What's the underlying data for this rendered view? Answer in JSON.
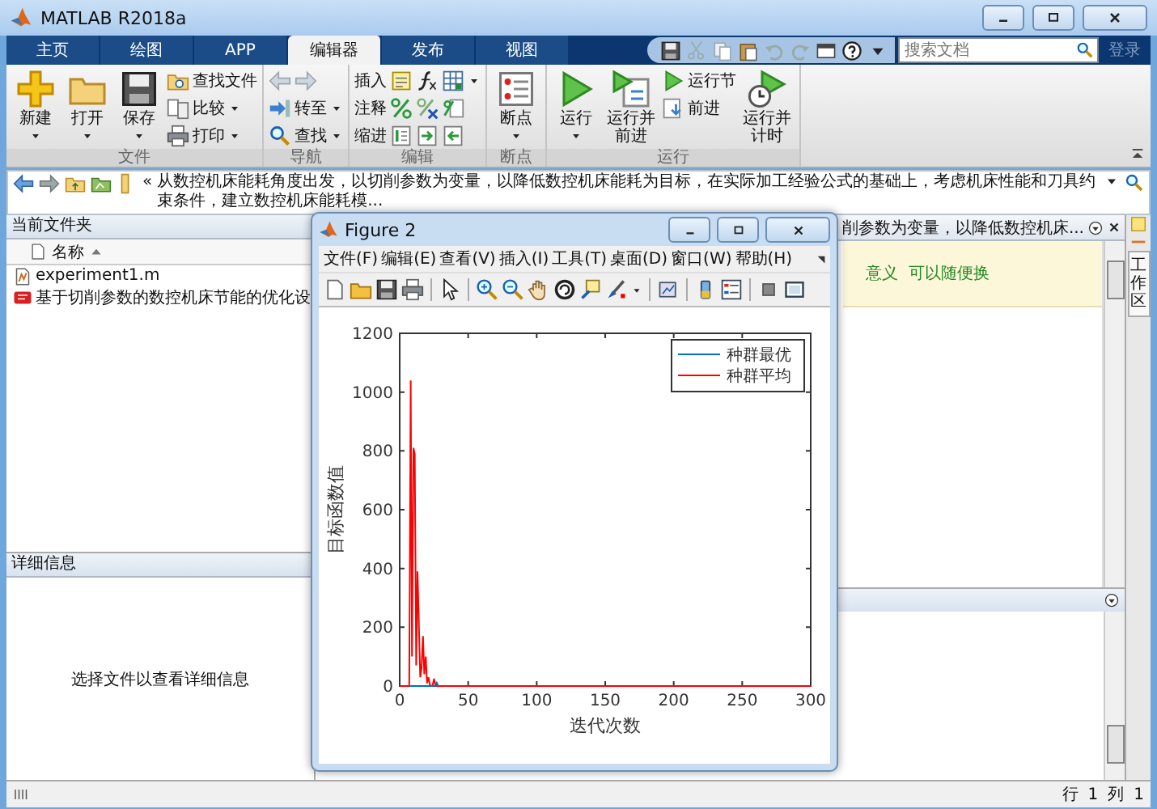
{
  "window": {
    "title": "MATLAB R2018a"
  },
  "tabs": [
    {
      "label": "主页",
      "selected": false
    },
    {
      "label": "绘图",
      "selected": false
    },
    {
      "label": "APP",
      "selected": false
    },
    {
      "label": "编辑器",
      "selected": true
    },
    {
      "label": "发布",
      "selected": false
    },
    {
      "label": "视图",
      "selected": false
    }
  ],
  "search": {
    "placeholder": "搜索文档"
  },
  "login": "登录",
  "ribbon": {
    "groups": [
      {
        "title": "文件",
        "columns": [
          [
            [
              {
                "kind": "large",
                "label": "新建",
                "menu": true
              }
            ]
          ],
          [
            [
              {
                "kind": "large",
                "label": "打开",
                "menu": true
              }
            ]
          ],
          [
            [
              {
                "kind": "large",
                "label": "保存",
                "menu": true
              }
            ]
          ],
          [
            [
              {
                "kind": "small",
                "label": "查找文件",
                "menu": false
              }
            ],
            [
              {
                "kind": "small",
                "label": "比较",
                "menu": true
              }
            ],
            [
              {
                "kind": "small",
                "label": "打印",
                "menu": true
              }
            ]
          ]
        ]
      },
      {
        "title": "导航",
        "columns": [
          [
            [
              {
                "kind": "icon",
                "menu": false
              },
              {
                "kind": "icon",
                "menu": false
              }
            ],
            [
              {
                "kind": "small",
                "label": "转至",
                "menu": true
              }
            ],
            [
              {
                "kind": "small",
                "label": "查找",
                "menu": true
              }
            ]
          ]
        ]
      },
      {
        "title": "编辑",
        "columns": [
          [
            [
              {
                "kind": "label",
                "label": "插入"
              },
              {
                "kind": "icon",
                "menu": false
              },
              {
                "kind": "icon",
                "menu": false
              },
              {
                "kind": "icon",
                "menu": true
              }
            ],
            [
              {
                "kind": "label",
                "label": "注释"
              },
              {
                "kind": "icon",
                "menu": false
              },
              {
                "kind": "icon",
                "menu": false
              },
              {
                "kind": "icon",
                "menu": false
              }
            ],
            [
              {
                "kind": "label",
                "label": "缩进"
              },
              {
                "kind": "icon",
                "menu": false
              },
              {
                "kind": "icon",
                "menu": false
              },
              {
                "kind": "icon",
                "menu": false
              }
            ]
          ]
        ]
      },
      {
        "title": "断点",
        "columns": [
          [
            [
              {
                "kind": "large",
                "label": "断点",
                "menu": true
              }
            ]
          ]
        ]
      },
      {
        "title": "运行",
        "columns": [
          [
            [
              {
                "kind": "large",
                "label": "运行",
                "menu": true
              }
            ]
          ],
          [
            [
              {
                "kind": "large",
                "label": "运行并前进",
                "menu": false
              }
            ]
          ],
          [
            [
              {
                "kind": "small",
                "label": "运行节",
                "menu": false
              }
            ],
            [
              {
                "kind": "small",
                "label": "前进",
                "menu": false
              }
            ]
          ],
          [
            [
              {
                "kind": "large",
                "label": "运行并计时",
                "menu": false
              }
            ]
          ]
        ]
      }
    ]
  },
  "address": {
    "prefix": "«",
    "path": "从数控机床能耗角度出发，以切削参数为变量，以降低数控机床能耗为目标，在实际加工经验公式的基础上，考虑机床性能和刀具约束条件，建立数控机床能耗模..."
  },
  "current_folder": {
    "title": "当前文件夹",
    "column": "名称",
    "files": [
      {
        "name": "experiment1.m",
        "kind": "script"
      },
      {
        "name": "基于切削参数的数控机床节能的优化设",
        "kind": "pdf"
      }
    ]
  },
  "details": {
    "title": "详细信息",
    "message": "选择文件以查看详细信息"
  },
  "editor": {
    "tab": "削参数为变量，以降低数控机床...",
    "line": "意义  可以随便换"
  },
  "side_tab": "工作区",
  "status_bar": {
    "row_label": "行",
    "row": "1",
    "col_label": "列",
    "col": "1"
  },
  "figure": {
    "title": "Figure 2",
    "menu": [
      "文件(F)",
      "编辑(E)",
      "查看(V)",
      "插入(I)",
      "工具(T)",
      "桌面(D)",
      "窗口(W)",
      "帮助(H)"
    ],
    "chart_data": {
      "type": "line",
      "legend": "upper right",
      "xlabel": "迭代次数",
      "ylabel": "目标函数值",
      "xlim": [
        0,
        300
      ],
      "ylim": [
        0,
        1200
      ],
      "xticks": [
        0,
        50,
        100,
        150,
        200,
        250,
        300
      ],
      "yticks": [
        0,
        200,
        400,
        600,
        800,
        1000,
        1200
      ],
      "x": [
        0,
        7,
        8,
        9,
        10,
        11,
        12,
        13,
        14,
        15,
        16,
        17,
        18,
        19,
        20,
        21,
        22,
        23,
        24,
        25,
        26,
        27,
        28,
        30,
        300
      ],
      "series": [
        {
          "name": "种群最优",
          "color": "#0072bd",
          "values": [
            null,
            0,
            0,
            0,
            0,
            0,
            0,
            0,
            0,
            0,
            0,
            0,
            0,
            0,
            0,
            0,
            0,
            0,
            0,
            0,
            0,
            10,
            0,
            null,
            null
          ]
        },
        {
          "name": "种群平均",
          "color": "#ff0000",
          "values": [
            0,
            0,
            1040,
            100,
            810,
            790,
            70,
            390,
            200,
            30,
            60,
            170,
            40,
            100,
            10,
            30,
            5,
            0,
            0,
            25,
            5,
            0,
            0,
            0,
            0
          ]
        }
      ]
    }
  }
}
